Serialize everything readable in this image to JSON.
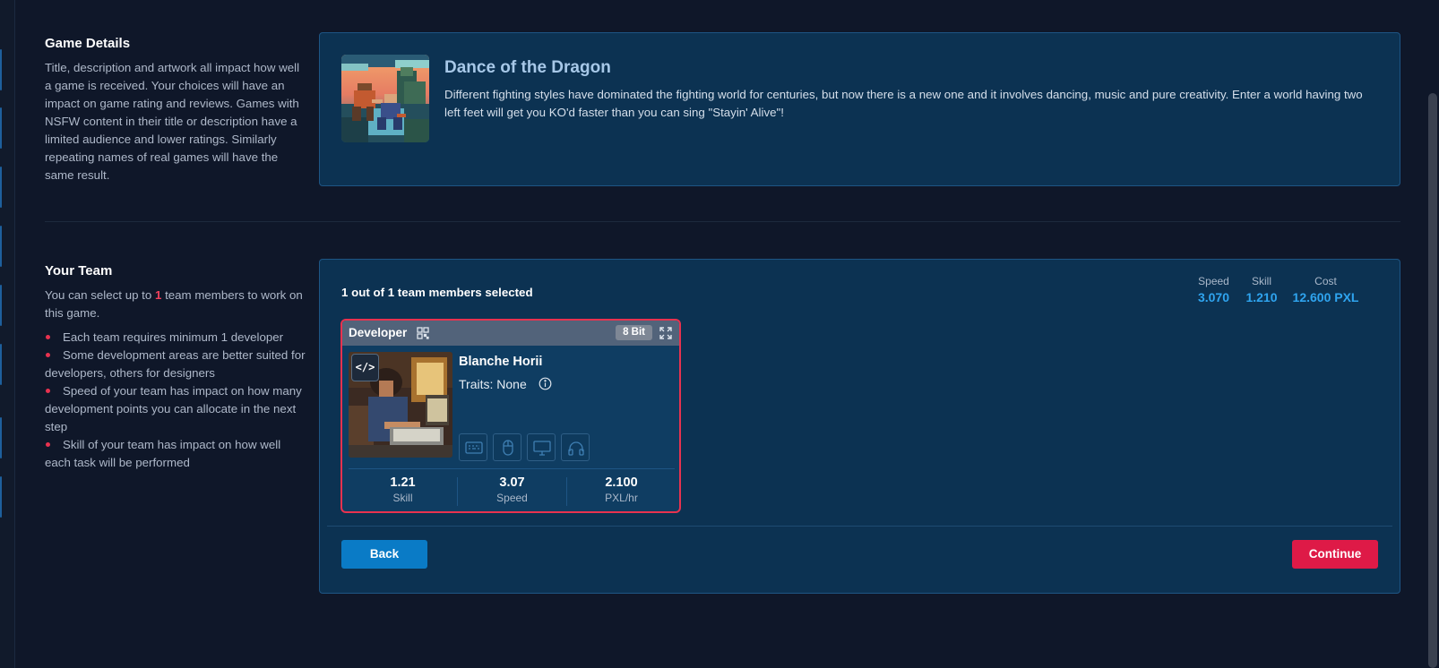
{
  "game_details": {
    "title": "Game Details",
    "description": "Title, description and artwork all impact how well a game is received. Your choices will have an impact on game rating and reviews. Games with NSFW content in their title or description have a limited audience and lower ratings. Similarly repeating names of real games will have the same result."
  },
  "game": {
    "title": "Dance of the Dragon",
    "description": "Different fighting styles have dominated the fighting world for centuries, but now there is a new one and it involves dancing, music and pure creativity. Enter a world having two left feet will get you KO'd faster than you can sing \"Stayin' Alive\"!"
  },
  "team": {
    "title": "Your Team",
    "intro_prefix": "You can select up to ",
    "intro_count": "1",
    "intro_suffix": " team members to work on this game.",
    "bullets": [
      "Each team requires minimum 1 developer",
      "Some development areas are better suited for developers, others for designers",
      "Speed of your team has impact on how many development points you can allocate in the next step",
      "Skill of your team has impact on how well each task will be performed"
    ],
    "selected_text": "1 out of 1 team members selected",
    "totals": {
      "speed_label": "Speed",
      "speed_value": "3.070",
      "skill_label": "Skill",
      "skill_value": "1.210",
      "cost_label": "Cost",
      "cost_value": "12.600 PXL"
    },
    "member": {
      "role": "Developer",
      "badge": "8 Bit",
      "code_icon_text": "</>",
      "name": "Blanche Horii",
      "traits": "Traits: None",
      "skill_icons": [
        "keyboard-icon",
        "mouse-icon",
        "monitor-icon",
        "headphones-icon"
      ],
      "stats": [
        {
          "value": "1.21",
          "label": "Skill"
        },
        {
          "value": "3.07",
          "label": "Speed"
        },
        {
          "value": "2.100",
          "label": "PXL/hr"
        }
      ]
    }
  },
  "buttons": {
    "back": "Back",
    "continue": "Continue"
  },
  "colors": {
    "accent_blue": "#0a7bc6",
    "accent_red": "#de1a47",
    "value_blue": "#2fa4ef"
  }
}
